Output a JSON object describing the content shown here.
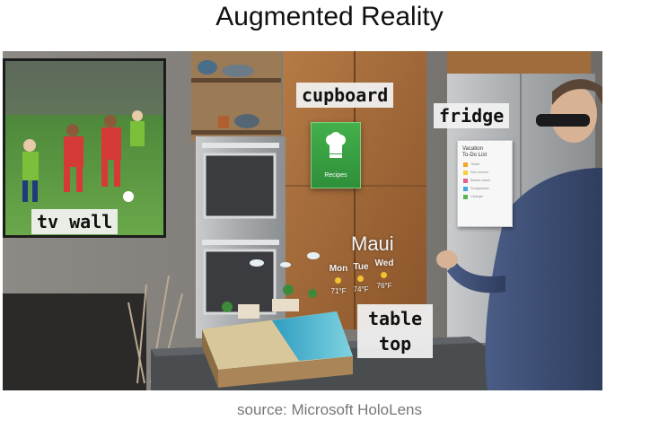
{
  "title": "Augmented Reality",
  "source": "source: Microsoft HoloLens",
  "labels": {
    "cupboard": "cupboard",
    "fridge": "fridge",
    "tv_wall": "tv wall",
    "table_top_line1": "table",
    "table_top_line2": "top"
  },
  "hologram_recipe": {
    "label": "Recipes",
    "color": "#3fa845"
  },
  "hologram_weather": {
    "city": "Maui",
    "days": [
      {
        "day": "Mon",
        "temp": "71°F"
      },
      {
        "day": "Tue",
        "temp": "74°F"
      },
      {
        "day": "Wed",
        "temp": "76°F"
      }
    ]
  },
  "hologram_todo": {
    "title_line1": "Vacation",
    "title_line2": "To-Do List",
    "items": [
      {
        "text": "Ticket",
        "color": "#f5a623"
      },
      {
        "text": "Sun screen",
        "color": "#f7d038"
      },
      {
        "text": "Beach towel",
        "color": "#e85d8a"
      },
      {
        "text": "Sunglasses",
        "color": "#43a6e0"
      },
      {
        "text": "Charger",
        "color": "#5ab552"
      }
    ]
  }
}
